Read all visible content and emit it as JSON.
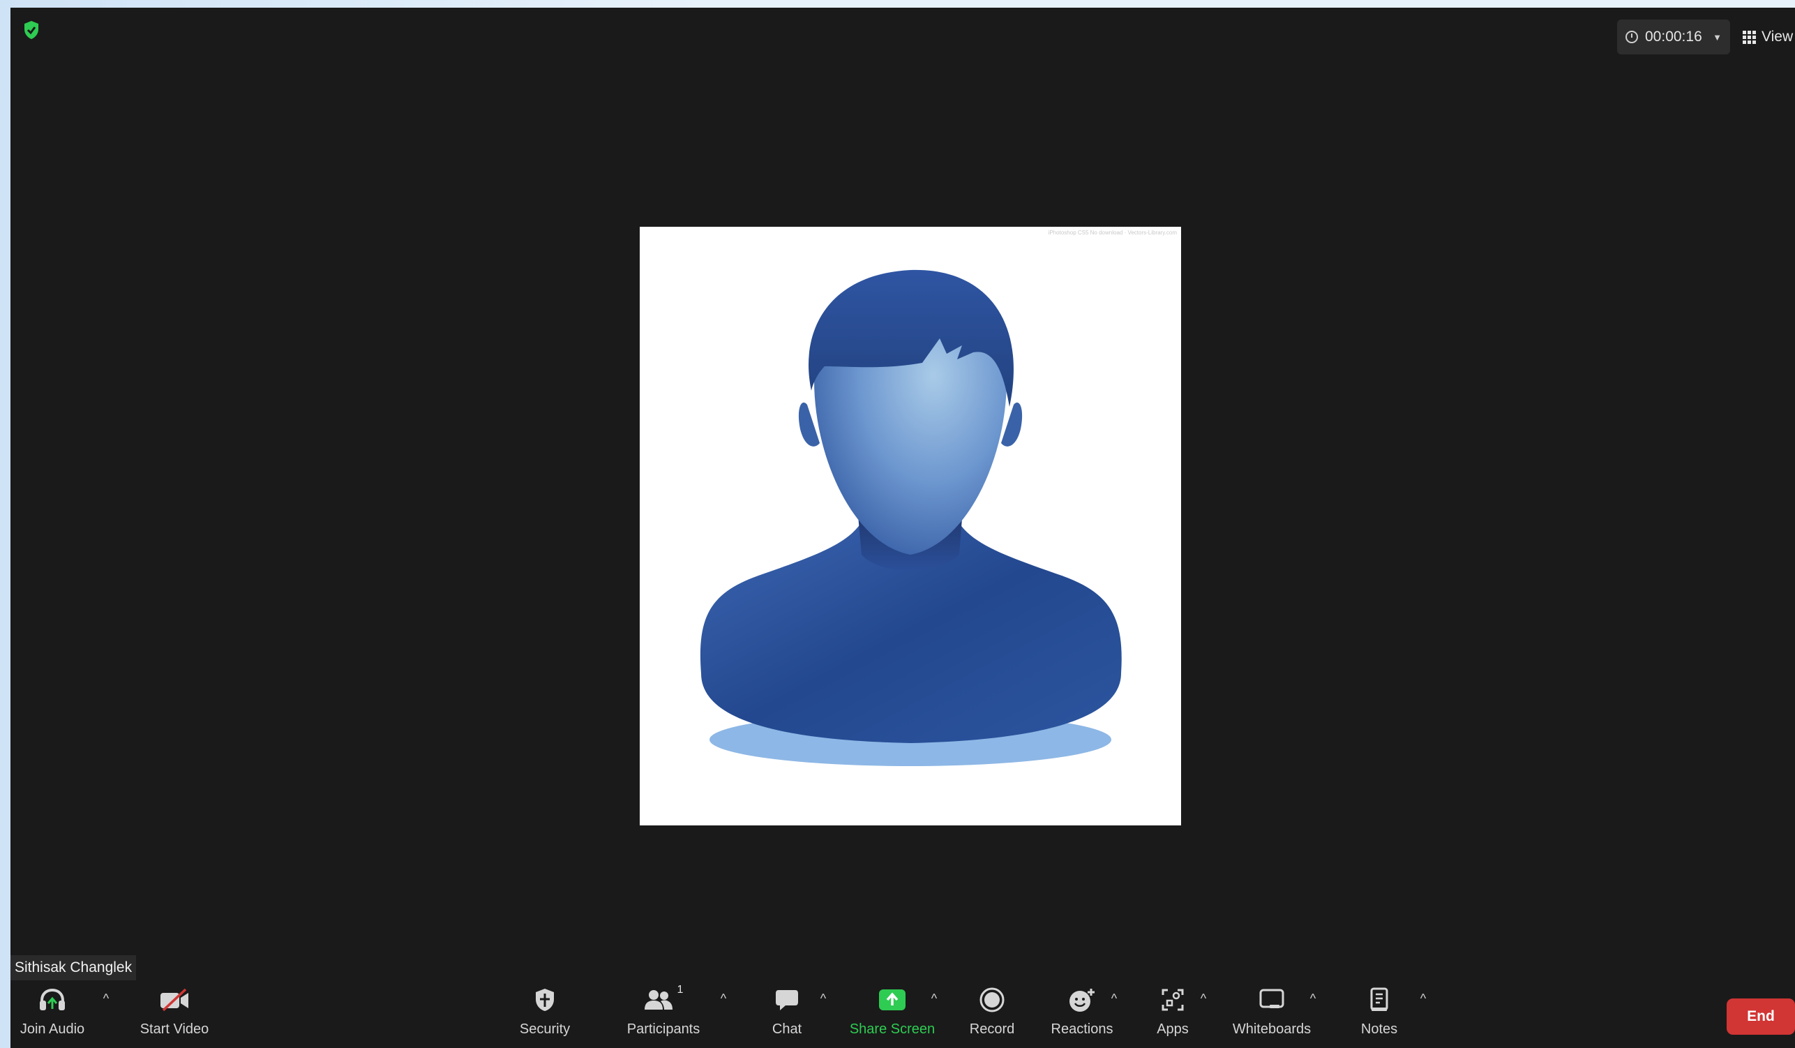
{
  "meeting": {
    "timer": "00:00:16",
    "view_label": "View",
    "participant_name": "Sithisak Changlek",
    "watermark": "iPhotoshop CS5 No download · Vectors-Library.com"
  },
  "toolbar": {
    "join_audio": "Join Audio",
    "start_video": "Start Video",
    "security": "Security",
    "participants": "Participants",
    "participants_count": "1",
    "chat": "Chat",
    "share_screen": "Share Screen",
    "record": "Record",
    "reactions": "Reactions",
    "apps": "Apps",
    "whiteboards": "Whiteboards",
    "notes": "Notes",
    "end": "End"
  },
  "colors": {
    "window_bg": "#1a1a1a",
    "accent_green": "#2ecc52",
    "end_red": "#d13534",
    "avatar_blue": "#2b4f99"
  },
  "icons": [
    "shield-check-icon",
    "clock-icon",
    "grid-icon",
    "headphones-icon",
    "video-off-icon",
    "security-shield-icon",
    "participants-icon",
    "chat-bubble-icon",
    "share-screen-icon",
    "record-icon",
    "reactions-icon",
    "apps-icon",
    "whiteboard-icon",
    "notes-icon"
  ]
}
